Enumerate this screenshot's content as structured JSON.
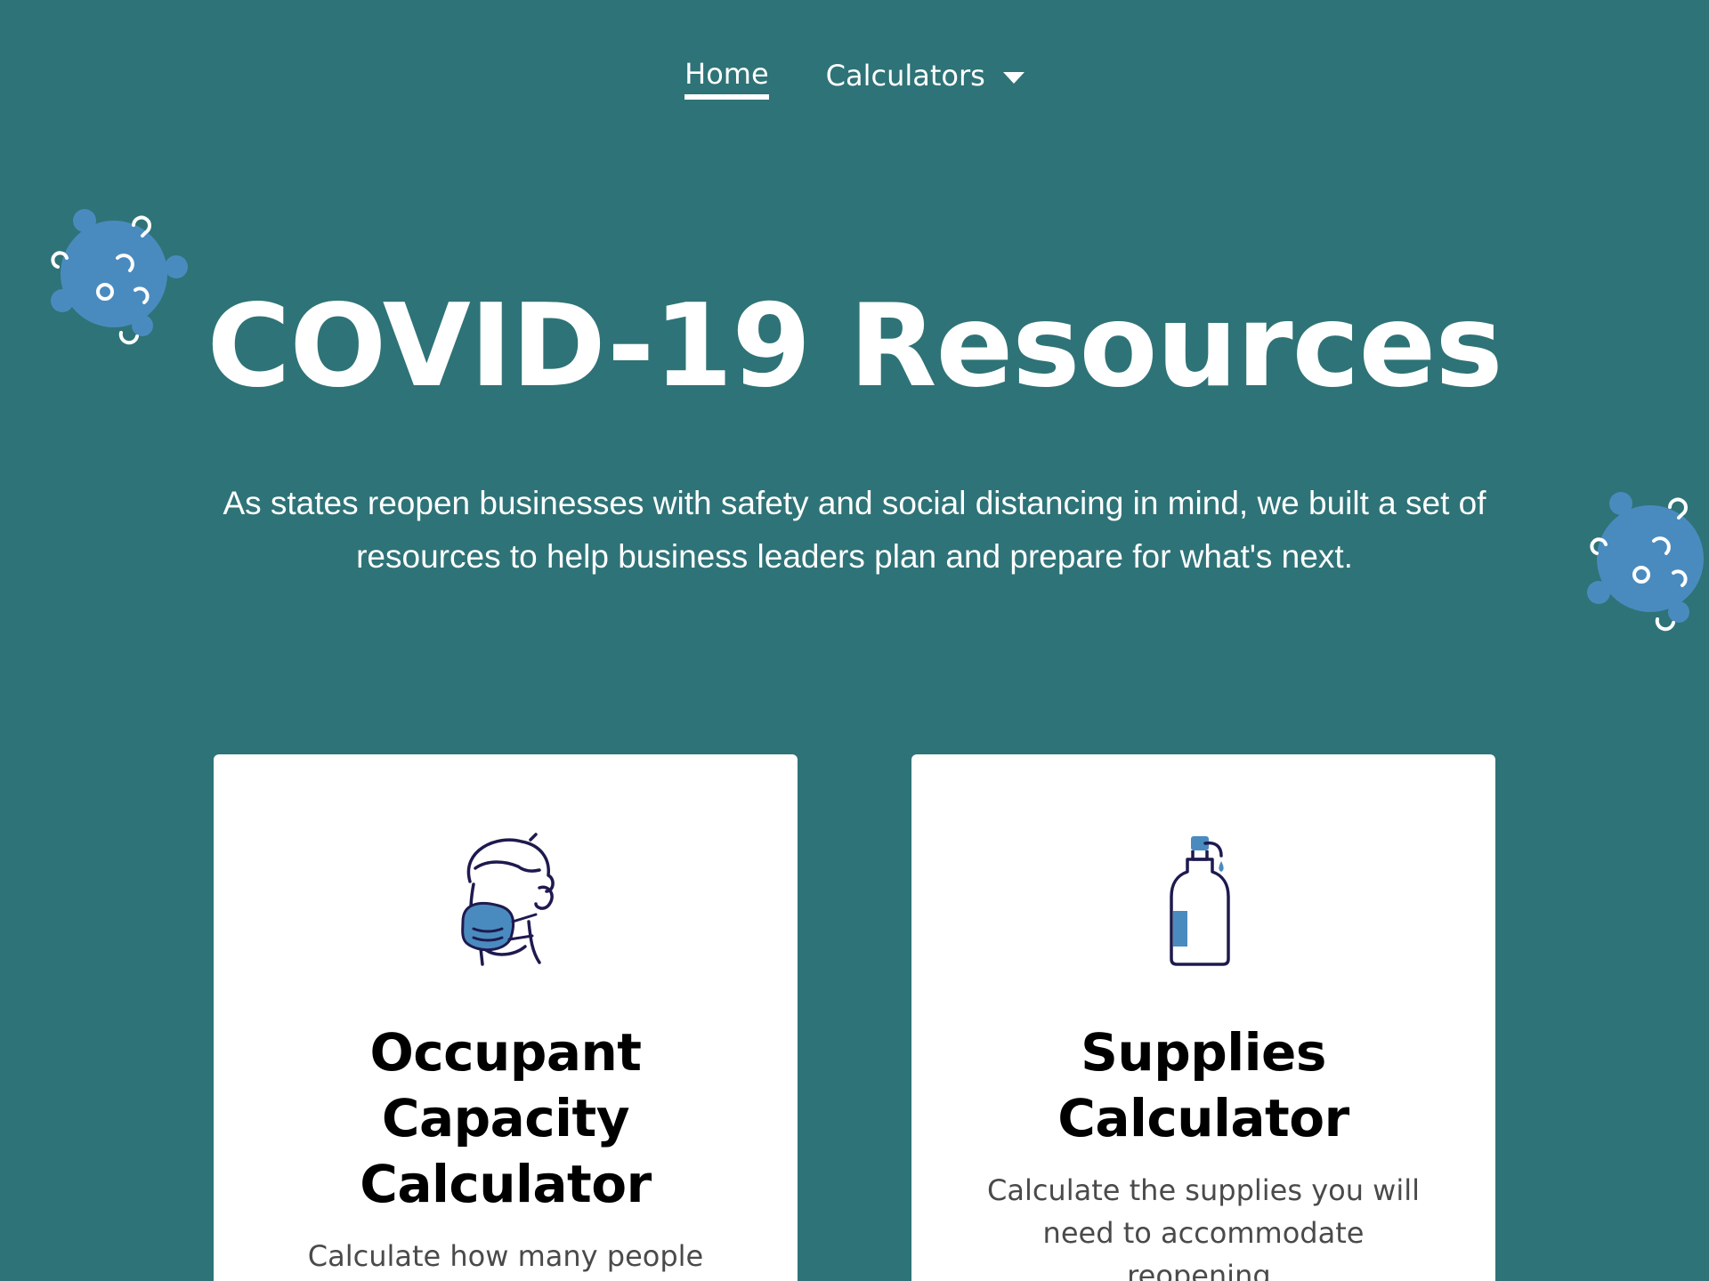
{
  "nav": {
    "items": [
      {
        "label": "Home",
        "active": true
      },
      {
        "label": "Calculators",
        "has_dropdown": true
      }
    ]
  },
  "hero": {
    "title": "COVID-19 Resources",
    "subtitle": "As states reopen businesses with safety and social distancing in mind, we built a set of resources to help business leaders plan and prepare for what's next."
  },
  "cards": [
    {
      "icon": "person-mask-icon",
      "title": "Occupant Capacity Calculator",
      "description": "Calculate how many people your business can"
    },
    {
      "icon": "sanitizer-bottle-icon",
      "title": "Supplies Calculator",
      "description": "Calculate the supplies you will need to accommodate reopening."
    }
  ],
  "colors": {
    "background": "#2e7377",
    "virus": "#4a8bbf",
    "card": "#ffffff",
    "icon_stroke": "#1e1a4f",
    "icon_accent": "#4a8bbf"
  }
}
